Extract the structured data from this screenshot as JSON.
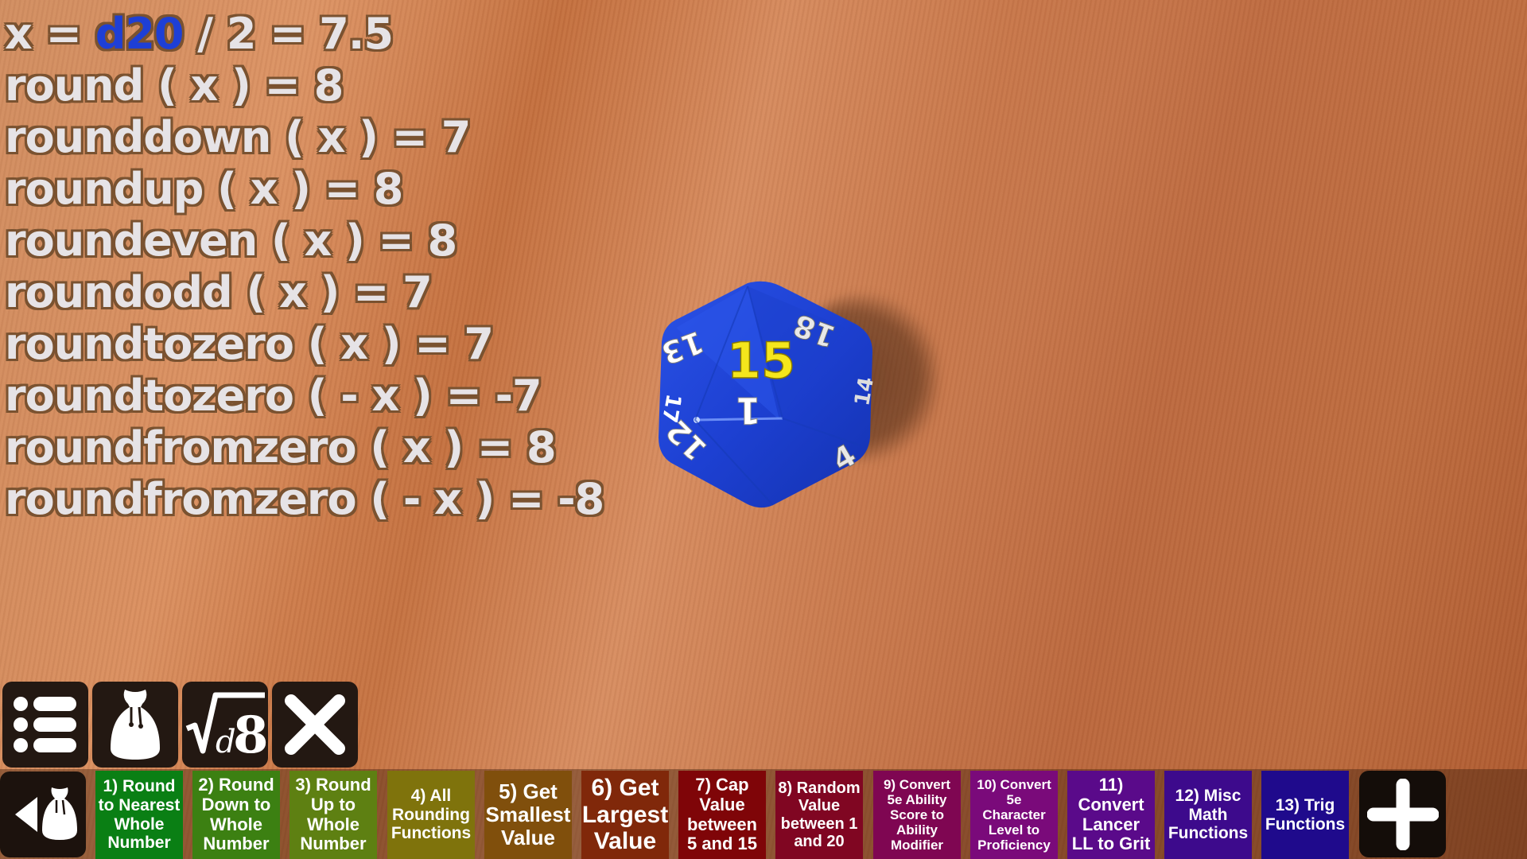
{
  "formula_readout": {
    "header": {
      "prefix": "x = ",
      "die": "d20",
      "suffix": " / 2 = 7.5",
      "die_color": "#1e3fd6"
    },
    "lines": [
      "round ( x ) = 8",
      "rounddown ( x ) = 7",
      "roundup ( x ) = 8",
      "roundeven ( x ) = 8",
      "roundodd ( x ) = 7",
      "roundtozero ( x ) = 7",
      "roundtozero ( - x ) = -7",
      "roundfromzero ( x ) = 8",
      "roundfromzero ( - x ) = -8"
    ]
  },
  "die": {
    "type": "d20",
    "color": "#1f3fd0",
    "result": "15",
    "result_color": "#f5e61c",
    "visible_faces": [
      "13",
      "18",
      "1",
      "12",
      "4",
      "17",
      "14"
    ]
  },
  "toolbar": {
    "menu_label": "menu-icon",
    "dice_bag_label": "dice-bag-icon",
    "formula_label": "formula-icon",
    "formula_glyph_root": "√",
    "formula_glyph_d": "d",
    "formula_glyph_8": "8",
    "clear_label": "close-icon"
  },
  "bottom_bar": {
    "back_label": "back-to-dice-bag",
    "add_label": "add-icon",
    "presets": [
      {
        "label": "1) Round to Nearest Whole Number",
        "lines": [
          "1) Round",
          "to Nearest",
          "Whole",
          "Number"
        ],
        "color": "#0a7f14",
        "font": 21
      },
      {
        "label": "2) Round Down to Whole Number",
        "lines": [
          "2) Round",
          "Down to",
          "Whole",
          "Number"
        ],
        "color": "#3c8012",
        "font": 22
      },
      {
        "label": "3) Round Up to Whole Number",
        "lines": [
          "3) Round",
          "Up to",
          "Whole",
          "Number"
        ],
        "color": "#5e8012",
        "font": 22
      },
      {
        "label": "4) All Rounding Functions",
        "lines": [
          "4) All",
          "Rounding",
          "Functions"
        ],
        "color": "#7f730c",
        "font": 21
      },
      {
        "label": "5) Get Smallest Value",
        "lines": [
          "5) Get",
          "Smallest",
          "Value"
        ],
        "color": "#804f0c",
        "font": 26
      },
      {
        "label": "6) Get Largest Value",
        "lines": [
          "6) Get",
          "Largest",
          "Value"
        ],
        "color": "#80280a",
        "font": 30
      },
      {
        "label": "7) Cap Value between 5 and 15",
        "lines": [
          "7) Cap",
          "Value",
          "between",
          "5 and 15"
        ],
        "color": "#7f0508",
        "font": 22
      },
      {
        "label": "8) Random Value between 1 and 20",
        "lines": [
          "8) Random",
          "Value",
          "between 1",
          "and 20"
        ],
        "color": "#800622",
        "font": 20
      },
      {
        "label": "9) Convert 5e Ability Score to Ability Modifier",
        "lines": [
          "9) Convert",
          "5e Ability",
          "Score to",
          "Ability",
          "Modifier"
        ],
        "color": "#7f0652",
        "font": 17
      },
      {
        "label": "10) Convert 5e Character Level to Proficiency",
        "lines": [
          "10) Convert",
          "5e",
          "Character",
          "Level to",
          "Proficiency"
        ],
        "color": "#7a0a7a",
        "font": 17
      },
      {
        "label": "11) Convert Lancer LL to Grit",
        "lines": [
          "11)",
          "Convert",
          "Lancer",
          "LL to Grit"
        ],
        "color": "#5a0a8a",
        "font": 22
      },
      {
        "label": "12) Misc Math Functions",
        "lines": [
          "12) Misc",
          "Math",
          "Functions"
        ],
        "color": "#3d0a8c",
        "font": 21
      },
      {
        "label": "13) Trig Functions",
        "lines": [
          "13) Trig",
          "Functions"
        ],
        "color": "#1f0a8c",
        "font": 21
      }
    ]
  }
}
